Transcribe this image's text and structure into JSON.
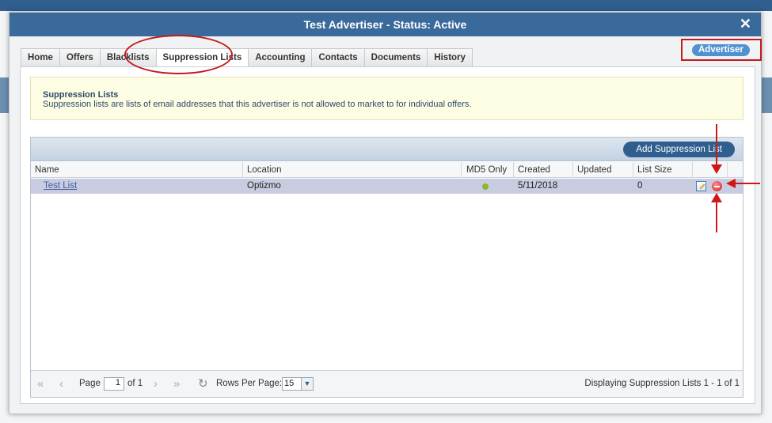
{
  "modal": {
    "title": "Test Advertiser - Status: Active",
    "close_symbol": "✕",
    "badge": "Advertiser"
  },
  "tabs": [
    {
      "label": "Home"
    },
    {
      "label": "Offers"
    },
    {
      "label": "Blacklists"
    },
    {
      "label": "Suppression Lists",
      "active": true
    },
    {
      "label": "Accounting"
    },
    {
      "label": "Contacts"
    },
    {
      "label": "Documents"
    },
    {
      "label": "History"
    }
  ],
  "notice": {
    "title": "Suppression Lists",
    "text": "Suppression lists are lists of email addresses that this advertiser is not allowed to market to for individual offers."
  },
  "grid": {
    "add_button": "Add Suppression List",
    "columns": [
      "Name",
      "Location",
      "MD5 Only",
      "Created",
      "Updated",
      "List Size"
    ],
    "rows": [
      {
        "name": "Test List",
        "location": "Optizmo",
        "md5_only": true,
        "created": "5/11/2018",
        "updated": "",
        "list_size": "0"
      }
    ]
  },
  "pager": {
    "page_label": "Page",
    "page_value": "1",
    "of_label": "of 1",
    "rows_label": "Rows Per Page:",
    "rows_value": "15",
    "info": "Displaying Suppression Lists 1 - 1 of 1"
  },
  "icons": {
    "first": "first-page-icon",
    "prev": "prev-page-icon",
    "next": "next-page-icon",
    "last": "last-page-icon",
    "refresh": "refresh-icon",
    "edit": "edit-icon",
    "delete": "delete-icon"
  },
  "colors": {
    "header": "#3a6a9b",
    "accent": "#2f5e8f",
    "badge": "#4f92cf",
    "annotation": "#c41a1a",
    "md5_dot": "#8db630"
  }
}
